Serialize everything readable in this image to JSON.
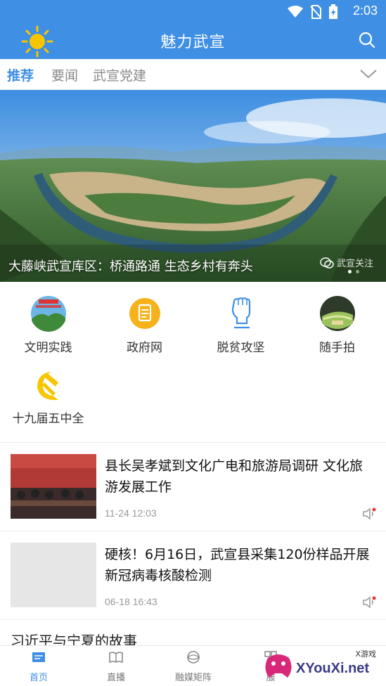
{
  "status_bar": {
    "time": "2:03"
  },
  "app_bar": {
    "title": "魅力武宣"
  },
  "tabs": [
    {
      "label": "推荐",
      "active": true
    },
    {
      "label": "要闻",
      "active": false
    },
    {
      "label": "武宣党建",
      "active": false
    }
  ],
  "banner": {
    "caption": "大藤峡武宣库区：桥通路通 生态乡村有奔头",
    "watermark": "武宣关注"
  },
  "shortcuts": [
    {
      "label": "文明实践",
      "icon": "civilization-badge-icon"
    },
    {
      "label": "政府网",
      "icon": "document-icon"
    },
    {
      "label": "脱贫攻坚",
      "icon": "fist-icon"
    },
    {
      "label": "随手拍",
      "icon": "camera-photo-icon"
    },
    {
      "label": "十九届五中全",
      "icon": "hammer-sickle-icon"
    }
  ],
  "news": [
    {
      "headline": "县长吴孝斌到文化广电和旅游局调研 文化旅游发展工作",
      "date": "11-24 12:03"
    },
    {
      "headline": "硬核！6月16日，武宣县采集120份样品开展新冠病毒核酸检测",
      "date": "06-18 16:43"
    }
  ],
  "partial_headline": "习近平与宁夏的故事",
  "bottom_nav": [
    {
      "label": "首页",
      "active": true
    },
    {
      "label": "直播",
      "active": false
    },
    {
      "label": "融媒矩阵",
      "active": false
    },
    {
      "label": "服",
      "active": false
    }
  ],
  "promo": {
    "text": "XYouXi.net",
    "small": "X游戏"
  },
  "colors": {
    "primary": "#3f8fe5",
    "sun": "#f7c600",
    "party_red": "#d8252a"
  }
}
